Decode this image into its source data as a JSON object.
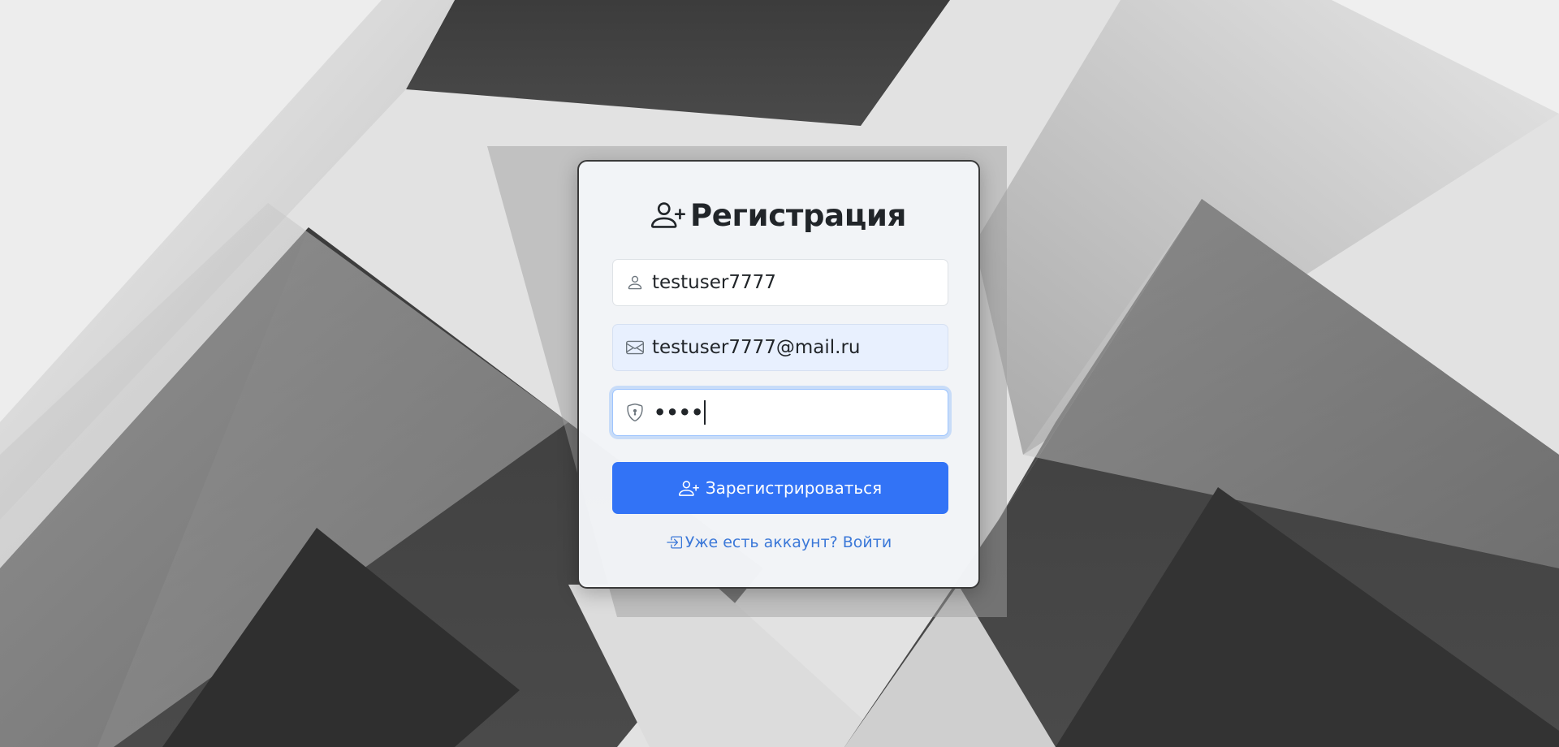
{
  "background": {
    "description_icon": "folded-paper-background"
  },
  "form": {
    "title": "Регистрация",
    "title_icon": "person-plus-icon",
    "username": {
      "value": "testuser7777",
      "icon": "person-icon"
    },
    "email": {
      "value": "testuser7777@mail.ru",
      "icon": "envelope-icon"
    },
    "password": {
      "masked_value": "••••",
      "icon": "shield-lock-icon"
    },
    "submit_label": "Зарегистрироваться",
    "submit_icon": "person-plus-icon",
    "login_link_label": "Уже есть аккаунт? Войти",
    "login_link_icon": "box-arrow-in-right-icon"
  },
  "colors": {
    "primary": "#3273f6",
    "link": "#3b78d8",
    "text": "#212529",
    "autofill_bg": "#e8f0fe"
  }
}
